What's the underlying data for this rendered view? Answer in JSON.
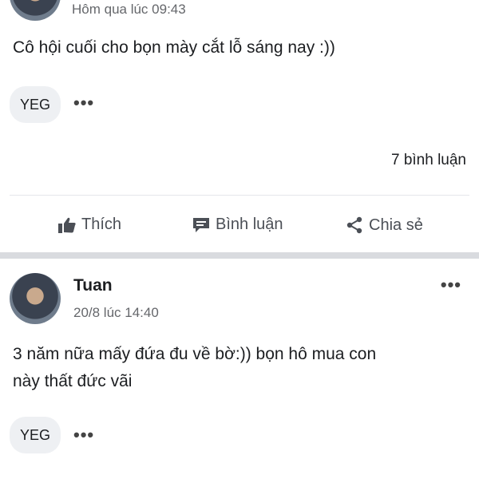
{
  "post1": {
    "timestamp": "Hôm qua lúc 09:43",
    "text": "Cô hội cuối cho bọn mày cắt lỗ sáng nay :))",
    "tag": "YEG",
    "more": "•••",
    "comments": "7 bình luận",
    "actions": {
      "like": "Thích",
      "comment": "Bình luận",
      "share": "Chia sẻ"
    }
  },
  "post2": {
    "author": "Tuan",
    "timestamp": "20/8 lúc 14:40",
    "text_line1": "3 năm nữa mấy đứa đu về bờ:)) bọn hô mua con",
    "text_line2": "này thất đức vãi",
    "tag": "YEG",
    "more": "•••",
    "options": "•••"
  },
  "colors": {
    "meta_text": "#65676b",
    "action_text": "#4b4f56",
    "pill_bg": "#eef0f3",
    "separator": "#d9dbdf"
  },
  "icons": [
    "thumbs-up-icon",
    "comment-icon",
    "share-icon",
    "more-horizontal-icon"
  ]
}
